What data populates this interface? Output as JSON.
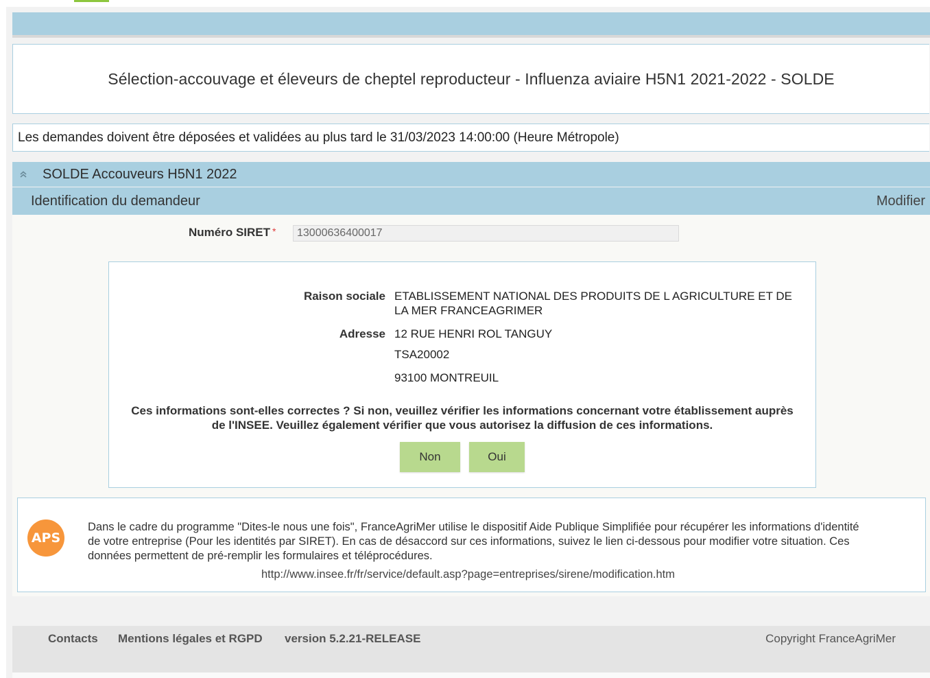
{
  "header": {
    "page_title": "Sélection-accouvage et éleveurs de cheptel reproducteur - Influenza aviaire H5N1 2021-2022 - SOLDE",
    "deadline_text": "Les demandes doivent être déposées et validées au plus tard le 31/03/2023 14:00:00 (Heure Métropole)"
  },
  "section": {
    "title": "SOLDE Accouveurs H5N1 2022",
    "subsection_title": "Identification du demandeur",
    "modify_label": "Modifier"
  },
  "form": {
    "siret_label": "Numéro SIRET",
    "siret_required_mark": "*",
    "siret_value": "13000636400017"
  },
  "company": {
    "raison_sociale_label": "Raison sociale",
    "raison_sociale_line1": "ETABLISSEMENT NATIONAL DES PRODUITS DE L AGRICULTURE ET DE",
    "raison_sociale_line2": "LA MER FRANCEAGRIMER",
    "adresse_label": "Adresse",
    "adresse_line1": "12 RUE HENRI ROL TANGUY",
    "adresse_line2": "TSA20002",
    "adresse_line3": "93100 MONTREUIL"
  },
  "confirmation": {
    "question_line1": "Ces informations sont-elles correctes ? Si non, veuillez vérifier les informations concernant votre établissement auprès",
    "question_line2": "de l'INSEE. Veuillez également vérifier que vous autorisez la diffusion de ces informations.",
    "no_label": "Non",
    "yes_label": "Oui"
  },
  "aps": {
    "logo_text": "APS",
    "text_line1": "Dans le cadre du programme \"Dites-le nous une fois\", FranceAgriMer utilise le dispositif Aide Publique Simplifiée pour récupérer les informations d'identité",
    "text_line2": "de votre entreprise (Pour les identités par SIRET). En cas de désaccord sur ces informations, suivez le lien ci-dessous pour modifier votre situation. Ces",
    "text_line3": "données permettent de pré-remplir les formulaires et téléprocédures.",
    "link": "http://www.insee.fr/fr/service/default.asp?page=entreprises/sirene/modification.htm"
  },
  "footer": {
    "contacts": "Contacts",
    "legal": "Mentions légales et RGPD",
    "version": "version 5.2.21-RELEASE",
    "copyright": "Copyright FranceAgriMer"
  },
  "colors": {
    "header_blue": "#a9cfe0",
    "button_green": "#b8d98e",
    "aps_orange": "#f7963b",
    "accent_green": "#8dc63f"
  }
}
